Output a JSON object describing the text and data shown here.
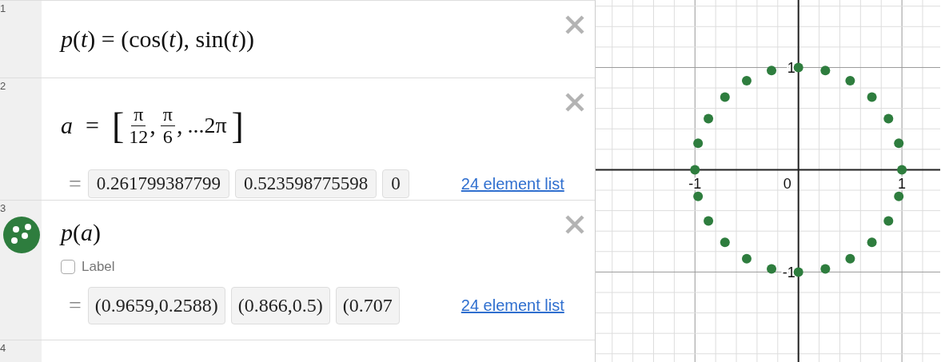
{
  "expressions": [
    {
      "number": "1",
      "kind": "formula",
      "deletable": true,
      "math": "*p*(*t*) = (cos(*t*), sin(*t*))"
    },
    {
      "number": "2",
      "kind": "list",
      "deletable": true,
      "lhs": "*a*",
      "eq": "=",
      "open": "[",
      "items": [
        {
          "num": "π",
          "den": "12"
        },
        {
          "num": "π",
          "den": "6"
        }
      ],
      "sep": ",",
      "tail": "...2π",
      "close": "]",
      "result": {
        "eq": "=",
        "values": [
          "0.261799387799",
          "0.523598775598",
          "0"
        ],
        "link": "24 element list"
      }
    },
    {
      "number": "3",
      "kind": "points",
      "deletable": true,
      "math": "*p*(*a*)",
      "label_checkbox": {
        "text": "Label",
        "checked": false
      },
      "result": {
        "eq": "=",
        "values": [
          "(0.9659,0.2588)",
          "(0.866,0.5)",
          "(0.707"
        ],
        "link": "24 element list"
      }
    },
    {
      "number": "4",
      "kind": "empty",
      "deletable": false
    }
  ],
  "graph": {
    "origin_label": "0",
    "chart_data": {
      "type": "scatter",
      "grid": true,
      "xlim": [
        -1.96,
        1.37
      ],
      "ylim": [
        -1.88,
        1.66
      ],
      "xticks": [
        {
          "value": -1,
          "label": "-1"
        },
        {
          "value": 1,
          "label": "1"
        }
      ],
      "yticks": [
        {
          "value": -1,
          "label": "-1"
        },
        {
          "value": 1,
          "label": "1"
        }
      ],
      "x": [
        0.97,
        0.87,
        0.71,
        0.5,
        0.26,
        0,
        -0.26,
        -0.5,
        -0.71,
        -0.87,
        -0.97,
        -1,
        -0.97,
        -0.87,
        -0.71,
        -0.5,
        -0.26,
        0,
        0.26,
        0.5,
        0.71,
        0.87,
        0.97,
        1
      ],
      "series": [
        {
          "color": "#2e7d3e",
          "values": [
            0.26,
            0.5,
            0.71,
            0.87,
            0.97,
            1,
            0.97,
            0.87,
            0.71,
            0.5,
            0.26,
            0,
            -0.26,
            -0.5,
            -0.71,
            -0.87,
            -0.97,
            -1,
            -0.97,
            -0.87,
            -0.71,
            -0.5,
            -0.26,
            0
          ]
        }
      ]
    }
  }
}
